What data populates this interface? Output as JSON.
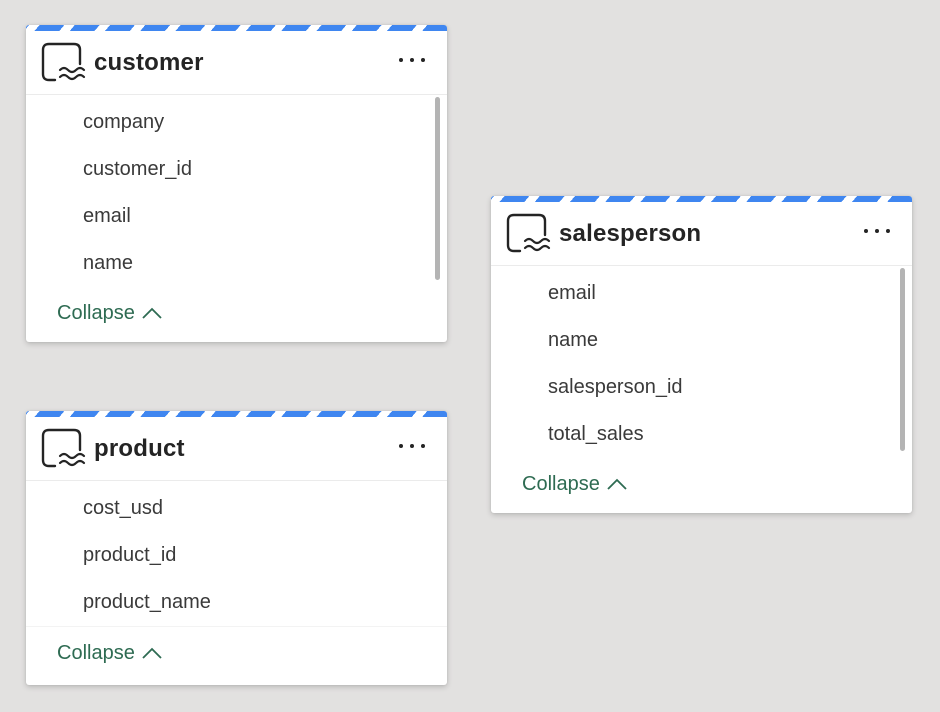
{
  "tables": [
    {
      "id": "customer",
      "title": "customer",
      "fields": [
        "company",
        "customer_id",
        "email",
        "name"
      ],
      "collapse_label": "Collapse"
    },
    {
      "id": "product",
      "title": "product",
      "fields": [
        "cost_usd",
        "product_id",
        "product_name"
      ],
      "collapse_label": "Collapse"
    },
    {
      "id": "salesperson",
      "title": "salesperson",
      "fields": [
        "email",
        "name",
        "salesperson_id",
        "total_sales"
      ],
      "collapse_label": "Collapse"
    }
  ],
  "icons": {
    "table": "lakehouse-table-icon",
    "more": "more-options-icon",
    "collapse": "chevron-up-icon"
  },
  "colors": {
    "canvas": "#e2e1e0",
    "header_stripe": "#3f86f0",
    "collapse_text": "#2e6b52"
  }
}
